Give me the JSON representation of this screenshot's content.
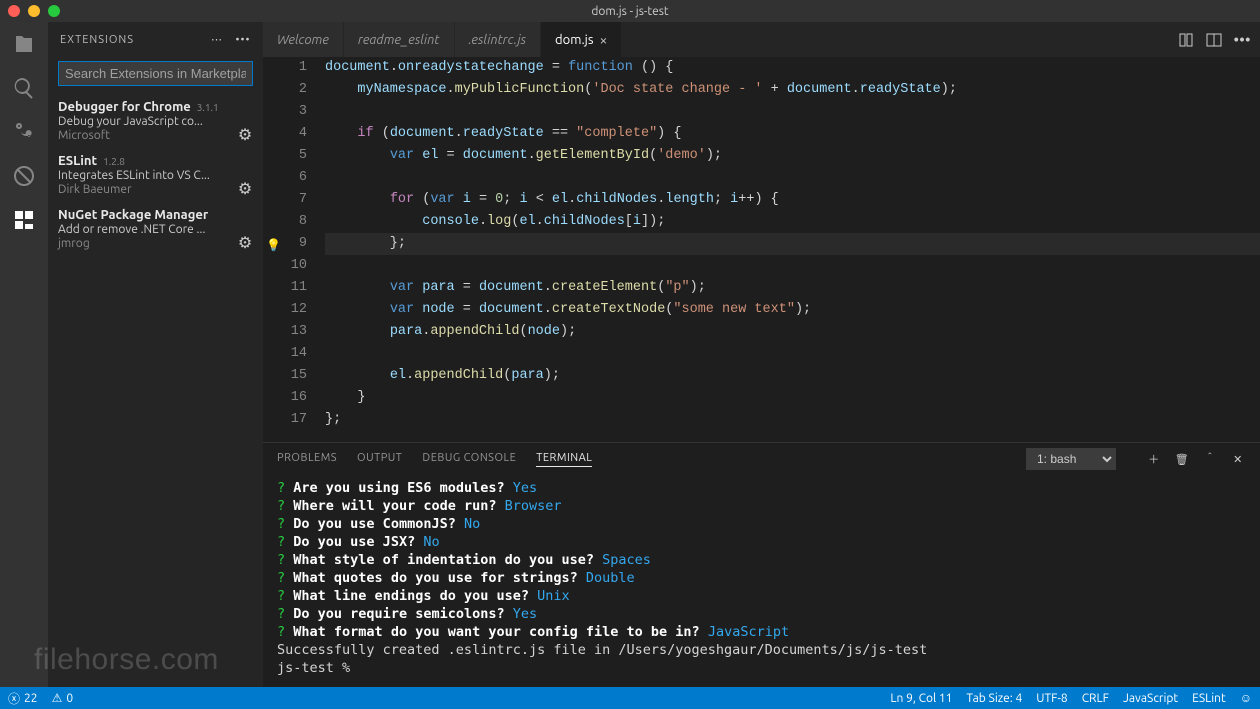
{
  "window": {
    "title": "dom.js - js-test"
  },
  "sidebar": {
    "title": "EXTENSIONS",
    "search_placeholder": "Search Extensions in Marketplace",
    "items": [
      {
        "name": "Debugger for Chrome",
        "version": "3.1.1",
        "desc": "Debug your JavaScript co...",
        "author": "Microsoft"
      },
      {
        "name": "ESLint",
        "version": "1.2.8",
        "desc": "Integrates ESLint into VS C...",
        "author": "Dirk Baeumer"
      },
      {
        "name": "NuGet Package Manager",
        "version": "",
        "desc": "Add or remove .NET Core ...",
        "author": "jmrog"
      }
    ]
  },
  "tabs": [
    {
      "label": "Welcome"
    },
    {
      "label": "readme_eslint"
    },
    {
      "label": ".eslintrc.js"
    },
    {
      "label": "dom.js"
    }
  ],
  "code_lines": [
    [
      [
        "obj",
        "document"
      ],
      [
        "op",
        "."
      ],
      [
        "obj",
        "onreadystatechange"
      ],
      [
        "op",
        " = "
      ],
      [
        "kw2",
        "function"
      ],
      [
        "op",
        " () {"
      ]
    ],
    [
      [
        "op",
        "    "
      ],
      [
        "obj",
        "myNamespace"
      ],
      [
        "op",
        "."
      ],
      [
        "fn",
        "myPublicFunction"
      ],
      [
        "op",
        "("
      ],
      [
        "str",
        "'Doc state change - '"
      ],
      [
        "op",
        " + "
      ],
      [
        "obj",
        "document"
      ],
      [
        "op",
        "."
      ],
      [
        "obj",
        "readyState"
      ],
      [
        "op",
        ");"
      ]
    ],
    [],
    [
      [
        "op",
        "    "
      ],
      [
        "kw",
        "if"
      ],
      [
        "op",
        " ("
      ],
      [
        "obj",
        "document"
      ],
      [
        "op",
        "."
      ],
      [
        "obj",
        "readyState"
      ],
      [
        "op",
        " == "
      ],
      [
        "str",
        "\"complete\""
      ],
      [
        "op",
        ") {"
      ]
    ],
    [
      [
        "op",
        "        "
      ],
      [
        "kw2",
        "var"
      ],
      [
        "op",
        " "
      ],
      [
        "obj",
        "el"
      ],
      [
        "op",
        " = "
      ],
      [
        "obj",
        "document"
      ],
      [
        "op",
        "."
      ],
      [
        "fn",
        "getElementById"
      ],
      [
        "op",
        "("
      ],
      [
        "str",
        "'demo'"
      ],
      [
        "op",
        ");"
      ]
    ],
    [],
    [
      [
        "op",
        "        "
      ],
      [
        "kw",
        "for"
      ],
      [
        "op",
        " ("
      ],
      [
        "kw2",
        "var"
      ],
      [
        "op",
        " "
      ],
      [
        "obj",
        "i"
      ],
      [
        "op",
        " = "
      ],
      [
        "num",
        "0"
      ],
      [
        "op",
        "; "
      ],
      [
        "obj",
        "i"
      ],
      [
        "op",
        " < "
      ],
      [
        "obj",
        "el"
      ],
      [
        "op",
        "."
      ],
      [
        "obj",
        "childNodes"
      ],
      [
        "op",
        "."
      ],
      [
        "obj",
        "length"
      ],
      [
        "op",
        "; "
      ],
      [
        "obj",
        "i"
      ],
      [
        "op",
        "++) {"
      ]
    ],
    [
      [
        "op",
        "            "
      ],
      [
        "obj",
        "console"
      ],
      [
        "op",
        "."
      ],
      [
        "fn",
        "log"
      ],
      [
        "op",
        "("
      ],
      [
        "obj",
        "el"
      ],
      [
        "op",
        "."
      ],
      [
        "obj",
        "childNodes"
      ],
      [
        "op",
        "["
      ],
      [
        "obj",
        "i"
      ],
      [
        "op",
        "]);"
      ]
    ],
    [
      [
        "op",
        "        };"
      ]
    ],
    [],
    [
      [
        "op",
        "        "
      ],
      [
        "kw2",
        "var"
      ],
      [
        "op",
        " "
      ],
      [
        "obj",
        "para"
      ],
      [
        "op",
        " = "
      ],
      [
        "obj",
        "document"
      ],
      [
        "op",
        "."
      ],
      [
        "fn",
        "createElement"
      ],
      [
        "op",
        "("
      ],
      [
        "str",
        "\"p\""
      ],
      [
        "op",
        ");"
      ]
    ],
    [
      [
        "op",
        "        "
      ],
      [
        "kw2",
        "var"
      ],
      [
        "op",
        " "
      ],
      [
        "obj",
        "node"
      ],
      [
        "op",
        " = "
      ],
      [
        "obj",
        "document"
      ],
      [
        "op",
        "."
      ],
      [
        "fn",
        "createTextNode"
      ],
      [
        "op",
        "("
      ],
      [
        "str",
        "\"some new text\""
      ],
      [
        "op",
        ");"
      ]
    ],
    [
      [
        "op",
        "        "
      ],
      [
        "obj",
        "para"
      ],
      [
        "op",
        "."
      ],
      [
        "fn",
        "appendChild"
      ],
      [
        "op",
        "("
      ],
      [
        "obj",
        "node"
      ],
      [
        "op",
        ");"
      ]
    ],
    [],
    [
      [
        "op",
        "        "
      ],
      [
        "obj",
        "el"
      ],
      [
        "op",
        "."
      ],
      [
        "fn",
        "appendChild"
      ],
      [
        "op",
        "("
      ],
      [
        "obj",
        "para"
      ],
      [
        "op",
        ");"
      ]
    ],
    [
      [
        "op",
        "    }"
      ]
    ],
    [
      [
        "op",
        "};"
      ]
    ]
  ],
  "panel": {
    "tabs": [
      "PROBLEMS",
      "OUTPUT",
      "DEBUG CONSOLE",
      "TERMINAL"
    ],
    "active_tab": 3,
    "selector": "1: bash",
    "terminal_lines": [
      {
        "q": "Are you using ES6 modules?",
        "a": "Yes"
      },
      {
        "q": "Where will your code run?",
        "a": "Browser"
      },
      {
        "q": "Do you use CommonJS?",
        "a": "No"
      },
      {
        "q": "Do you use JSX?",
        "a": "No"
      },
      {
        "q": "What style of indentation do you use?",
        "a": "Spaces"
      },
      {
        "q": "What quotes do you use for strings?",
        "a": "Double"
      },
      {
        "q": "What line endings do you use?",
        "a": "Unix"
      },
      {
        "q": "Do you require semicolons?",
        "a": "Yes"
      },
      {
        "q": "What format do you want your config file to be in?",
        "a": "JavaScript"
      }
    ],
    "terminal_trailer": [
      "Successfully created .eslintrc.js file in /Users/yogeshgaur/Documents/js/js-test",
      "js-test %"
    ]
  },
  "status": {
    "errors_icon": "ⓧ",
    "errors": "22",
    "warnings_icon": "⚠",
    "warnings": "0",
    "cursor": "Ln 9, Col 11",
    "tab_size": "Tab Size: 4",
    "encoding": "UTF-8",
    "eol": "CRLF",
    "language": "JavaScript",
    "eslint": "ESLint"
  },
  "watermark": "filehorse.com"
}
